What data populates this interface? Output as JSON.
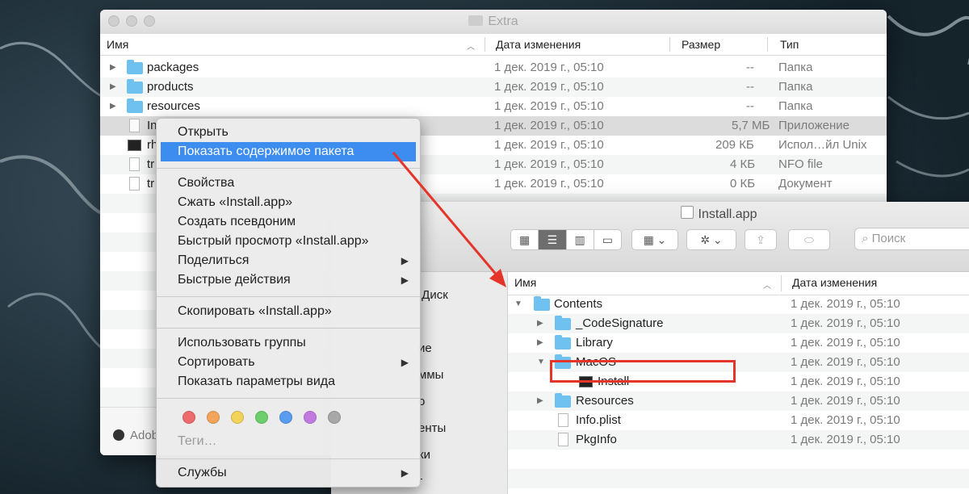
{
  "window1": {
    "title": "Extra",
    "columns": {
      "name": "Имя",
      "date": "Дата изменения",
      "size": "Размер",
      "kind": "Тип"
    },
    "rows": [
      {
        "name": "packages",
        "date": "1 дек. 2019 г., 05:10",
        "size": "--",
        "kind": "Папка"
      },
      {
        "name": "products",
        "date": "1 дек. 2019 г., 05:10",
        "size": "--",
        "kind": "Папка"
      },
      {
        "name": "resources",
        "date": "1 дек. 2019 г., 05:10",
        "size": "--",
        "kind": "Папка"
      },
      {
        "name": "In",
        "date": "1 дек. 2019 г., 05:10",
        "size": "5,7 МБ",
        "kind": "Приложение"
      },
      {
        "name": "rh",
        "date": "1 дек. 2019 г., 05:10",
        "size": "209 КБ",
        "kind": "Испол…йл Unix"
      },
      {
        "name": "tr",
        "date": "1 дек. 2019 г., 05:10",
        "size": "4 КБ",
        "kind": "NFO file"
      },
      {
        "name": "tr",
        "date": "1 дек. 2019 г., 05:10",
        "size": "0 КБ",
        "kind": "Документ"
      }
    ],
    "footer_item": "Adob"
  },
  "context_menu": {
    "items": {
      "open": "Открыть",
      "show_package": "Показать содержимое пакета",
      "info": "Свойства",
      "compress": "Сжать «Install.app»",
      "alias": "Создать псевдоним",
      "quicklook": "Быстрый просмотр «Install.app»",
      "share": "Поделиться",
      "quick_actions": "Быстрые действия",
      "copy": "Скопировать «Install.app»",
      "use_groups": "Использовать группы",
      "sort": "Сортировать",
      "view_options": "Показать параметры вида",
      "tags": "Теги…",
      "services": "Службы"
    },
    "tag_colors": [
      "#ee6b6b",
      "#f2a45a",
      "#f2d35a",
      "#6ccf6c",
      "#5a9cf0",
      "#c17be0",
      "#a8a8a8"
    ]
  },
  "window2": {
    "title": "Install.app",
    "search_placeholder": "Поиск",
    "columns": {
      "name": "Имя",
      "date": "Дата изменения"
    },
    "sidebar_fragments": [
      ".Диск",
      "ие",
      "ммы",
      "о",
      "енты",
      "ки",
      "г"
    ],
    "rows": [
      {
        "name": "Contents",
        "date": "1 дек. 2019 г., 05:10"
      },
      {
        "name": "_CodeSignature",
        "date": "1 дек. 2019 г., 05:10"
      },
      {
        "name": "Library",
        "date": "1 дек. 2019 г., 05:10"
      },
      {
        "name": "MacOS",
        "date": "1 дек. 2019 г., 05:10"
      },
      {
        "name": "Install",
        "date": "1 дек. 2019 г., 05:10"
      },
      {
        "name": "Resources",
        "date": "1 дек. 2019 г., 05:10"
      },
      {
        "name": "Info.plist",
        "date": "1 дек. 2019 г., 05:10"
      },
      {
        "name": "PkgInfo",
        "date": "1 дек. 2019 г., 05:10"
      }
    ]
  },
  "colors": {
    "highlight": "#3d8cf0",
    "annotation": "#e5352a",
    "folder": "#6fc1f0"
  }
}
